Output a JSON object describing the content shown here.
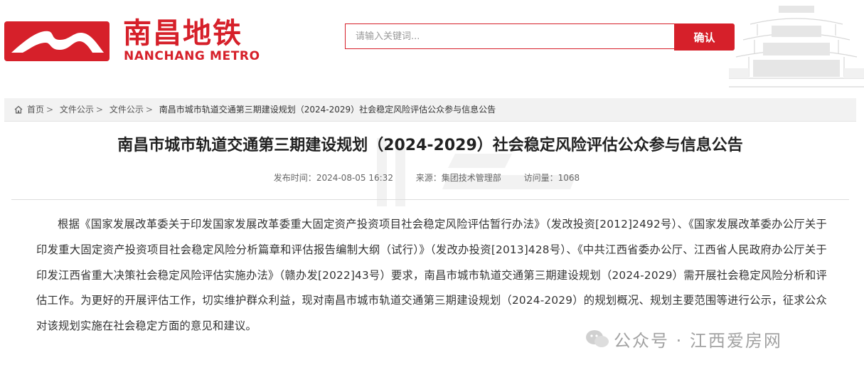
{
  "header": {
    "logo_cn": "南昌地铁",
    "logo_en": "NANCHANG METRO",
    "search_placeholder": "请输入关键词...",
    "search_button": "确认",
    "accent_color": "#d6202a"
  },
  "breadcrumb": {
    "icon": "home-icon",
    "items": [
      "首页",
      "文件公示",
      "文件公示"
    ],
    "separator": ">",
    "current": "南昌市城市轨道交通第三期建设规划（2024-2029）社会稳定风险评估公众参与信息公告"
  },
  "article": {
    "title": "南昌市城市轨道交通第三期建设规划（2024-2029）社会稳定风险评估公众参与信息公告",
    "meta": {
      "publish_label": "发布时间：",
      "publish_value": "2024-08-05 16:32",
      "source_label": "来源：",
      "source_value": "集团技术管理部",
      "views_label": "访问量：",
      "views_value": "1068"
    },
    "paragraph": "根据《国家发展改革委关于印发国家发展改革委重大固定资产投资项目社会稳定风险评估暂行办法》（发改投资[2012]2492号）、《国家发展改革委办公厅关于印发重大固定资产投资项目社会稳定风险分析篇章和评估报告编制大纲（试行）》（发改办投资[2013]428号）、《中共江西省委办公厅、江西省人民政府办公厅关于印发江西省重大决策社会稳定风险评估实施办法》（赣办发[2022]43号）要求，南昌市城市轨道交通第三期建设规划（2024-2029）需开展社会稳定风险分析和评估工作。为更好的开展评估工作，切实维护群众利益，现对南昌市城市轨道交通第三期建设规划（2024-2029）的规划概况、规划主要范围等进行公示，征求公众对该规划实施在社会稳定方面的意见和建议。"
  },
  "watermark": {
    "brand": "公众号 · 江西爱房网",
    "icon": "wechat-icon"
  }
}
